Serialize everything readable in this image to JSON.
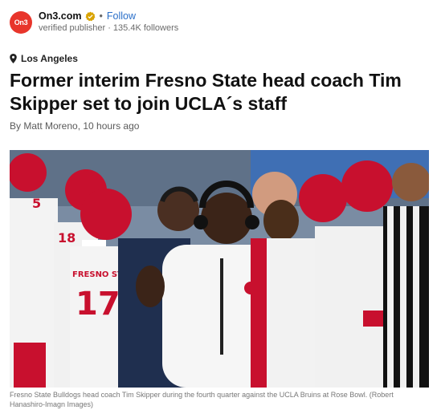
{
  "publisher": {
    "logo_text": "On3",
    "name": "On3.com",
    "follow_label": "Follow",
    "meta": "verified publisher · 135.4K followers",
    "brand_color": "#e8352b",
    "follow_color": "#2a6fc9",
    "verified_icon": "verified-badge-icon"
  },
  "article": {
    "location_icon": "location-pin-icon",
    "location": "Los Angeles",
    "headline": "Former interim Fresno State head coach Tim Skipper set to join UCLA´s staff",
    "byline": "By Matt Moreno, 10 hours ago"
  },
  "photo": {
    "jersey_numbers": [
      "5",
      "18",
      "17"
    ],
    "jersey_text": "FRESNO ST",
    "caption": "Fresno State Bulldogs head coach Tim Skipper during the fourth quarter against the UCLA Bruins at Rose Bowl. (Robert Hanashiro-Imagn Images)"
  }
}
